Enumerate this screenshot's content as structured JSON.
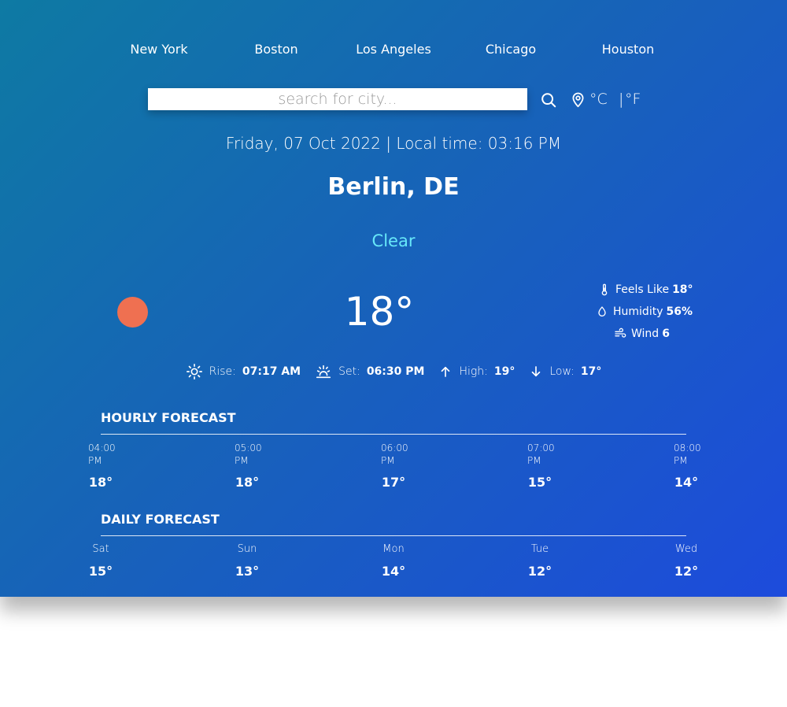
{
  "cities": [
    "New York",
    "Boston",
    "Los Angeles",
    "Chicago",
    "Houston"
  ],
  "search": {
    "placeholder": "search for city..."
  },
  "icons": {
    "search": "search-icon",
    "location": "map-pin-icon",
    "sunrise": "sun-icon",
    "sunset": "sunset-icon",
    "high": "arrow-up-icon",
    "low": "arrow-down-icon",
    "feels_like": "thermometer-icon",
    "humidity": "droplet-icon",
    "wind": "wind-icon",
    "weather": "sun-circle-icon"
  },
  "units": {
    "celsius": "°C",
    "separator": "|",
    "fahrenheit": "°F"
  },
  "datetime": "Friday, 07 Oct 2022 | Local time: 03:16 PM",
  "location": "Berlin, DE",
  "condition": "Clear",
  "temperature": "18°",
  "details": {
    "feels_like_label": "Feels Like",
    "feels_like_value": "18°",
    "humidity_label": "Humidity",
    "humidity_value": "56%",
    "wind_label": "Wind",
    "wind_value": "6"
  },
  "sun": {
    "rise_label": "Rise:",
    "rise_value": "07:17 AM",
    "set_label": "Set:",
    "set_value": "06:30 PM",
    "high_label": "High:",
    "high_value": "19°",
    "low_label": "Low:",
    "low_value": "17°"
  },
  "hourly": {
    "title": "HOURLY FORECAST",
    "items": [
      {
        "time": "04:00",
        "period": "PM",
        "temp": "18°"
      },
      {
        "time": "05:00",
        "period": "PM",
        "temp": "18°"
      },
      {
        "time": "06:00",
        "period": "PM",
        "temp": "17°"
      },
      {
        "time": "07:00",
        "period": "PM",
        "temp": "15°"
      },
      {
        "time": "08:00",
        "period": "PM",
        "temp": "14°"
      }
    ]
  },
  "daily": {
    "title": "DAILY FORECAST",
    "items": [
      {
        "day": "Sat",
        "temp": "15°"
      },
      {
        "day": "Sun",
        "temp": "13°"
      },
      {
        "day": "Mon",
        "temp": "14°"
      },
      {
        "day": "Tue",
        "temp": "12°"
      },
      {
        "day": "Wed",
        "temp": "12°"
      }
    ]
  },
  "colors": {
    "gradient_start": "#0e7aa3",
    "gradient_end": "#1d4bdc",
    "condition_text": "#67e8f9",
    "sun_circle": "#ef7051"
  }
}
